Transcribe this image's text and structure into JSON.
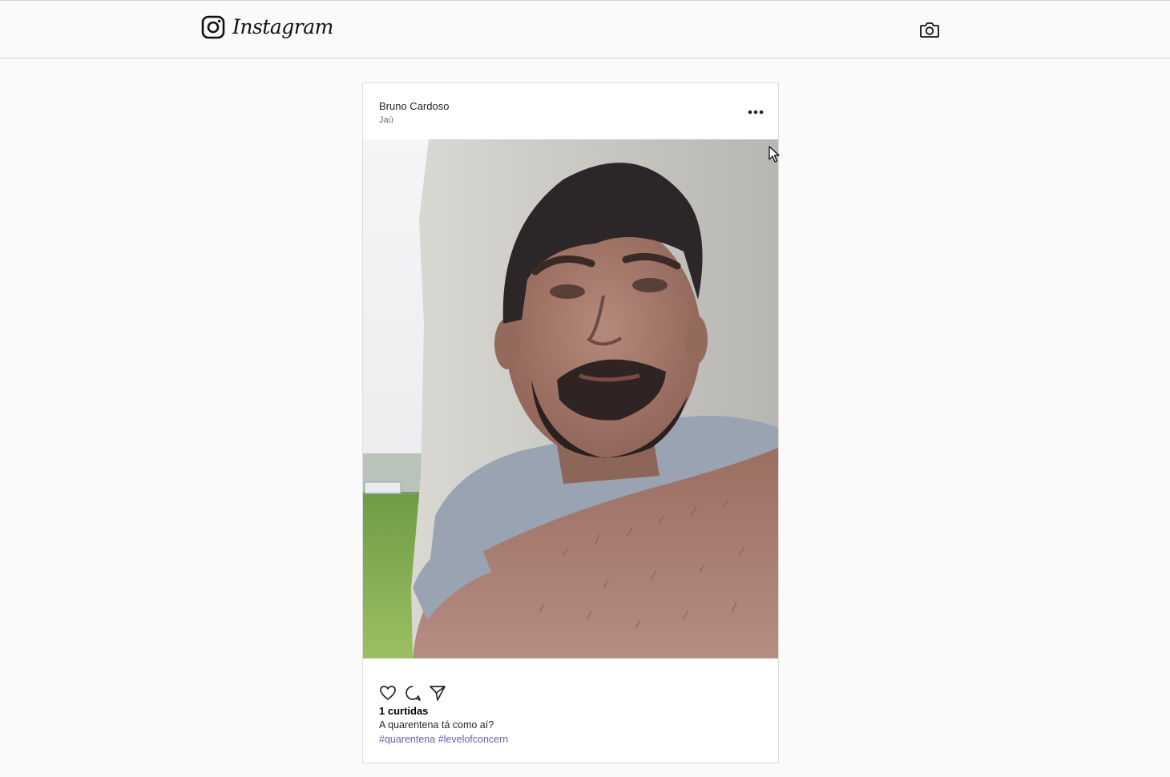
{
  "header": {
    "brand_name": "Instagram",
    "icons": {
      "logo": "instagram-logo-icon",
      "camera": "camera-icon"
    }
  },
  "post": {
    "author": "Bruno Cardoso",
    "location": "Jaú",
    "menu_icon": "more-options-icon",
    "actions": [
      "heart-icon",
      "comment-icon",
      "share-icon"
    ],
    "likes_text": "1 curtidas",
    "caption": "A quarentena tá como aí?",
    "hashtags": [
      "#quarentena",
      "#levelofconcern"
    ]
  },
  "colors": {
    "background": "#fafafa",
    "card": "#ffffff",
    "border": "#dbdbdb",
    "hashtag": "#6d5fa8",
    "text": "#262626"
  }
}
